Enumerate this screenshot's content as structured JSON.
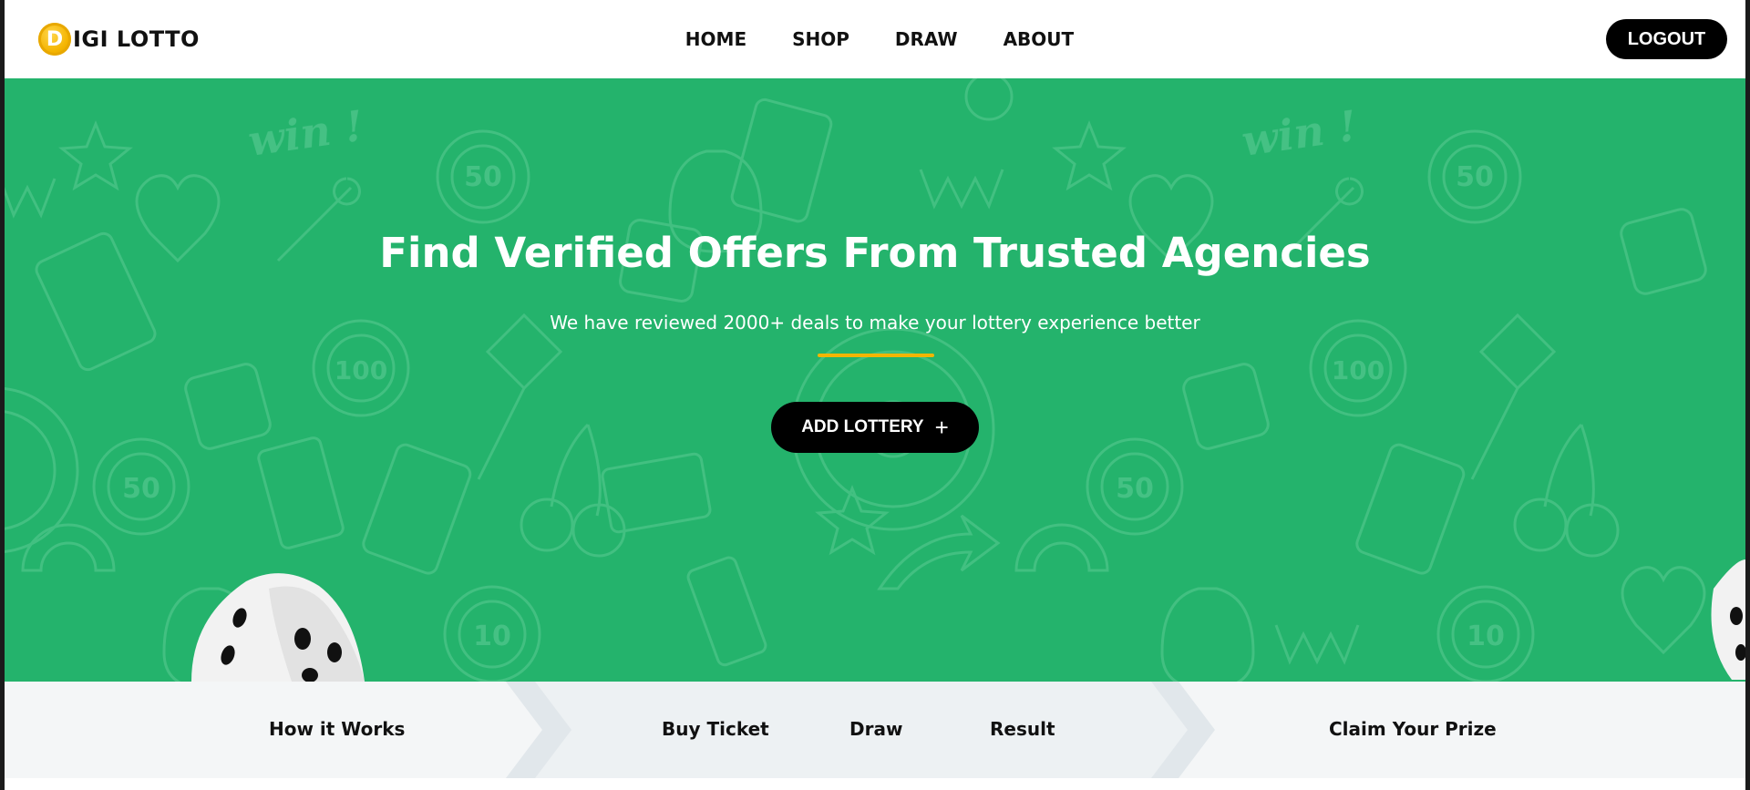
{
  "brand": {
    "logo_letter": "D",
    "logo_text": "IGI LOTTO"
  },
  "nav": {
    "items": [
      {
        "label": "HOME"
      },
      {
        "label": "SHOP"
      },
      {
        "label": "DRAW"
      },
      {
        "label": "ABOUT"
      }
    ],
    "logout_label": "LOGOUT"
  },
  "hero": {
    "title": "Find Verified Offers From Trusted Agencies",
    "subtitle": "We have reviewed 2000+ deals to make your lottery experience better",
    "cta_label": "ADD LOTTERY",
    "cta_icon": "plus-icon",
    "pattern_texts": [
      "win !",
      "50",
      "100",
      "10"
    ]
  },
  "steps": {
    "intro": "How it Works",
    "items": [
      {
        "label": "Buy Ticket"
      },
      {
        "label": "Draw"
      },
      {
        "label": "Result"
      }
    ],
    "final": "Claim Your Prize"
  },
  "colors": {
    "hero_bg": "#24b36c",
    "accent": "#f2b600",
    "button_bg": "#000000",
    "steps_bg": "#f4f6f7"
  }
}
